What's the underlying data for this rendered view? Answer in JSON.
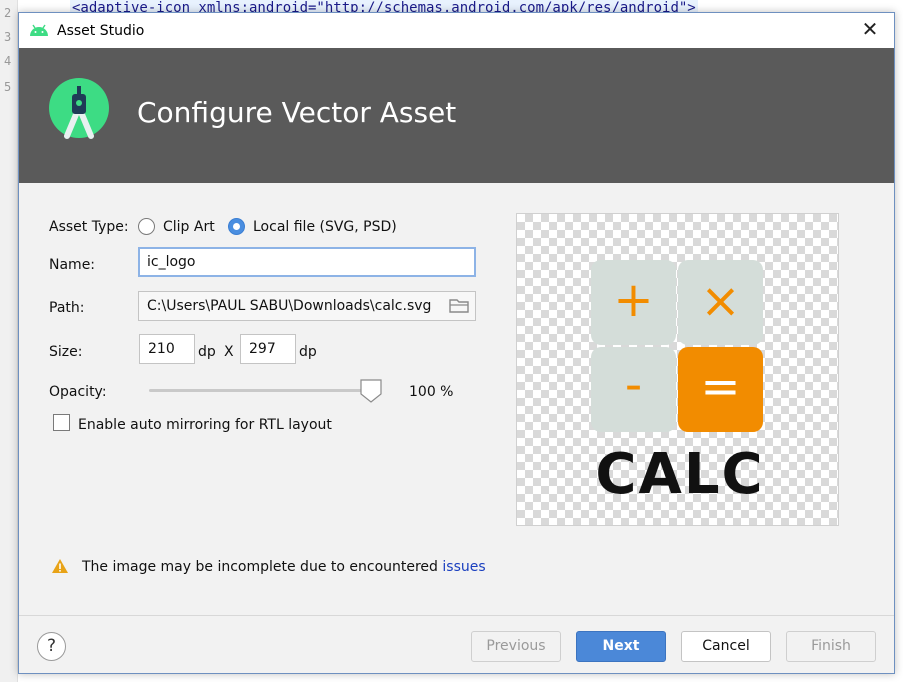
{
  "ide": {
    "line_numbers": [
      "2",
      "3",
      "4",
      "5"
    ],
    "code_line": "<adaptive-icon xmlns:android=\"http://schemas.android.com/apk/res/android\">"
  },
  "window": {
    "title": "Asset Studio",
    "close_label": "✕"
  },
  "banner": {
    "heading": "Configure Vector Asset"
  },
  "form": {
    "asset_type_label": "Asset Type:",
    "asset_type_options": [
      {
        "label": "Clip Art",
        "selected": false
      },
      {
        "label": "Local file (SVG, PSD)",
        "selected": true
      }
    ],
    "name_label": "Name:",
    "name_value": "ic_logo",
    "path_label": "Path:",
    "path_value": "C:\\Users\\PAUL SABU\\Downloads\\calc.svg",
    "size_label": "Size:",
    "width_value": "210",
    "height_value": "297",
    "unit_dp": "dp",
    "size_separator": "X",
    "opacity_label": "Opacity:",
    "opacity_value": "100 %",
    "opacity_level": 1.0,
    "rtl_label": "Enable auto mirroring for RTL layout",
    "rtl_checked": false
  },
  "preview": {
    "keys": [
      "+",
      "×",
      "-",
      "="
    ],
    "caption": "CALC"
  },
  "warning": {
    "text": "The image may be incomplete due to encountered ",
    "link": "issues"
  },
  "footer": {
    "help": "?",
    "previous": "Previous",
    "next": "Next",
    "cancel": "Cancel",
    "finish": "Finish"
  },
  "colors": {
    "banner": "#5a5a5a",
    "android_green": "#3ddc84",
    "primary_button": "#4b88d8",
    "calc_orange": "#f28c00",
    "calc_key": "#d4ddd9",
    "warning": "#e8a317",
    "link": "#1a3fbf"
  }
}
